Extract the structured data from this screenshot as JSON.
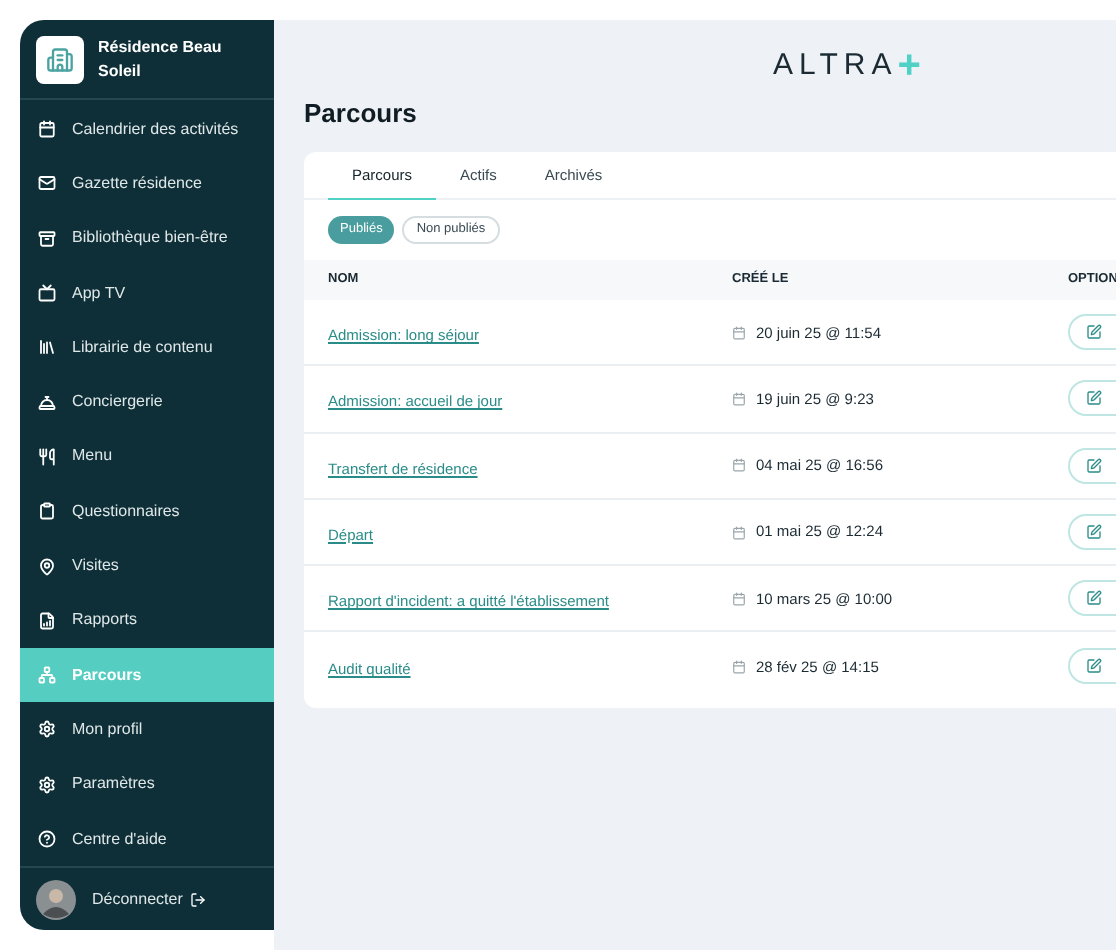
{
  "sidebar": {
    "title": "Résidence Beau Soleil",
    "items": [
      {
        "label": "Calendrier des activités",
        "selected": false
      },
      {
        "label": "Gazette résidence",
        "selected": false
      },
      {
        "label": "Bibliothèque bien-être",
        "selected": false
      },
      {
        "label": "App TV",
        "selected": false
      },
      {
        "label": "Librairie de contenu",
        "selected": false
      },
      {
        "label": "Conciergerie",
        "selected": false
      },
      {
        "label": "Menu",
        "selected": false
      },
      {
        "label": "Questionnaires",
        "selected": false
      },
      {
        "label": "Visites",
        "selected": false
      },
      {
        "label": "Rapports",
        "selected": false
      },
      {
        "label": "Parcours",
        "selected": true
      },
      {
        "label": "Mon profil",
        "selected": false
      },
      {
        "label": "Paramètres",
        "selected": false
      },
      {
        "label": "Centre d'aide",
        "selected": false
      }
    ],
    "logout": "Déconnecter"
  },
  "logo": {
    "text": "ALTRA",
    "mark": "+"
  },
  "page_title": "Parcours",
  "tabs": [
    {
      "label": "Parcours",
      "selected": true
    },
    {
      "label": "Actifs",
      "selected": false
    },
    {
      "label": "Archivés",
      "selected": false
    }
  ],
  "filters": [
    {
      "label": "Publiés",
      "selected": true
    },
    {
      "label": "Non publiés",
      "selected": false
    }
  ],
  "table": {
    "columns": [
      "NOM",
      "CRÉÉ LE",
      "OPTION"
    ],
    "rows": [
      {
        "name": "Admission: long séjour",
        "created": "20 juin 25 @ 11:54"
      },
      {
        "name": "Admission: accueil de jour",
        "created": "19 juin 25 @ 9:23"
      },
      {
        "name": "Transfert de résidence",
        "created": "04 mai 25 @ 16:56"
      },
      {
        "name": "Départ",
        "created": "01 mai 25 @ 12:24"
      },
      {
        "name": "Rapport d'incident: a quitté l'établissement",
        "created": "10 mars 25 @ 10:00"
      },
      {
        "name": "Audit qualité",
        "created": "28 fév 25 @ 14:15"
      }
    ]
  }
}
